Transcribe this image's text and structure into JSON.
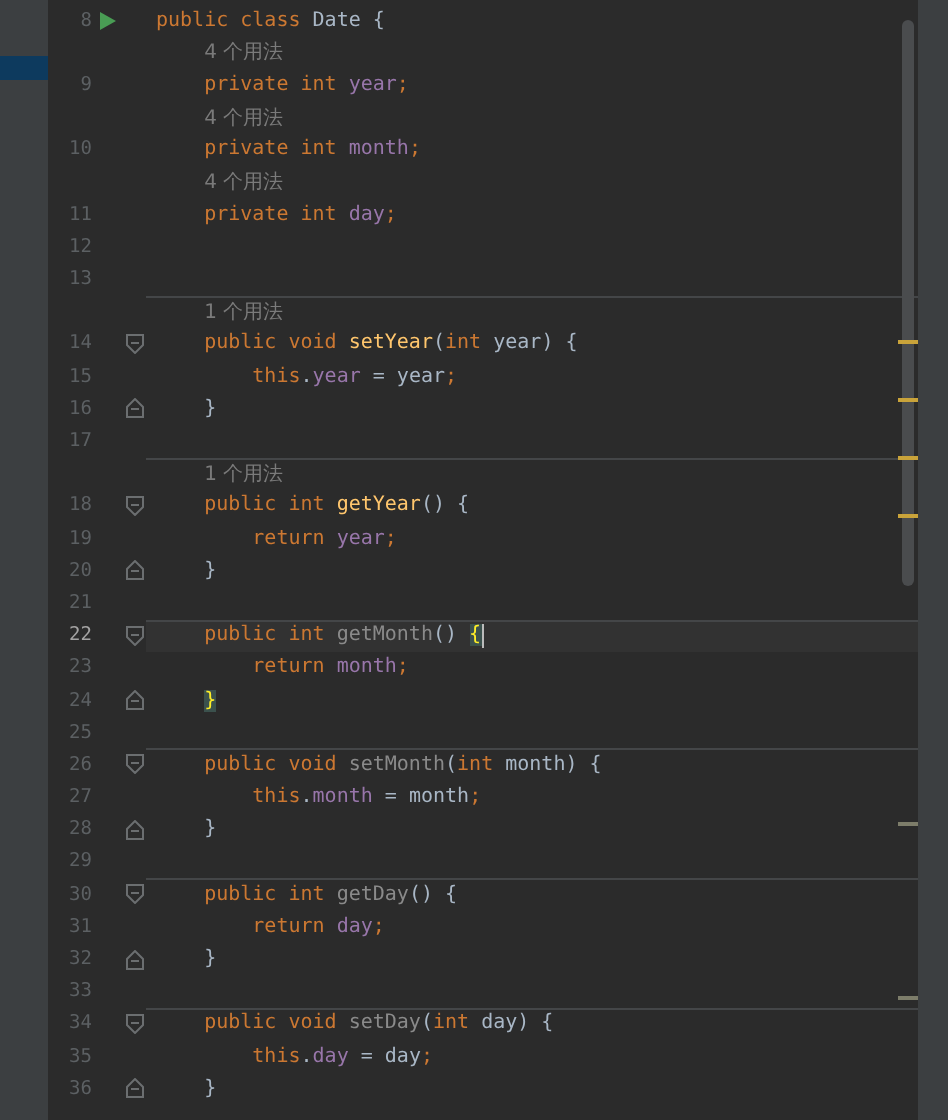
{
  "project_panel": {
    "row_highlighted": true
  },
  "editor": {
    "lines": [
      {
        "kind": "code",
        "number": "8",
        "run": true,
        "tokens": [
          {
            "keyword": "public class "
          },
          {
            "plain": "Date {"
          }
        ],
        "children": [
          {
            "kind": "hint",
            "text": "4 个用法"
          },
          {
            "kind": "code",
            "number": "9",
            "tokens": [
              {
                "keyword": "private int "
              },
              {
                "field": "year"
              },
              {
                "keyword": ";"
              }
            ]
          },
          {
            "kind": "hint",
            "text": "4 个用法"
          },
          {
            "kind": "code",
            "number": "10",
            "tokens": [
              {
                "keyword": "private int "
              },
              {
                "field": "month"
              },
              {
                "keyword": ";"
              }
            ]
          },
          {
            "kind": "hint",
            "text": "4 个用法"
          },
          {
            "kind": "code",
            "number": "11",
            "tokens": [
              {
                "keyword": "private int "
              },
              {
                "field": "day"
              },
              {
                "keyword": ";"
              }
            ]
          },
          {
            "kind": "code",
            "number": "12"
          },
          {
            "kind": "code",
            "number": "13"
          },
          {
            "kind": "hint",
            "text": "1 个用法",
            "separator": true
          },
          {
            "kind": "code",
            "number": "14",
            "fold_start": true,
            "tokens": [
              {
                "keyword": "public void "
              },
              {
                "declaration": "setYear"
              },
              {
                "plain": "("
              },
              {
                "keyword": "int "
              },
              {
                "plain": "year) {"
              }
            ],
            "children": [
              {
                "kind": "code",
                "number": "15",
                "tokens": [
                  {
                    "keyword": "this"
                  },
                  {
                    "plain": "."
                  },
                  {
                    "field": "year"
                  },
                  {
                    "plain": " = year"
                  },
                  {
                    "keyword": ";"
                  }
                ]
              }
            ]
          },
          {
            "kind": "code",
            "number": "16",
            "fold_end": true,
            "tokens": [
              {
                "plain": "}"
              }
            ]
          },
          {
            "kind": "code",
            "number": "17"
          },
          {
            "kind": "hint",
            "text": "1 个用法",
            "separator": true
          },
          {
            "kind": "code",
            "number": "18",
            "fold_start": true,
            "tokens": [
              {
                "keyword": "public int "
              },
              {
                "declaration": "getYear"
              },
              {
                "plain": "() {"
              }
            ],
            "children": [
              {
                "kind": "code",
                "number": "19",
                "tokens": [
                  {
                    "keyword": "return "
                  },
                  {
                    "field": "year"
                  },
                  {
                    "keyword": ";"
                  }
                ]
              }
            ]
          },
          {
            "kind": "code",
            "number": "20",
            "fold_end": true,
            "tokens": [
              {
                "plain": "}"
              }
            ]
          },
          {
            "kind": "code",
            "number": "21"
          },
          {
            "kind": "code",
            "number": "22",
            "fold_start": true,
            "separator": true,
            "current": true,
            "caret": true,
            "tokens": [
              {
                "keyword": "public int "
              },
              {
                "unused": "getMonth"
              },
              {
                "plain": "() "
              },
              {
                "brace_match": "{"
              }
            ],
            "children": [
              {
                "kind": "code",
                "number": "23",
                "tokens": [
                  {
                    "keyword": "return "
                  },
                  {
                    "field": "month"
                  },
                  {
                    "keyword": ";"
                  }
                ]
              }
            ]
          },
          {
            "kind": "code",
            "number": "24",
            "fold_end": true,
            "tokens": [
              {
                "brace_match": "}"
              }
            ]
          },
          {
            "kind": "code",
            "number": "25"
          },
          {
            "kind": "code",
            "number": "26",
            "fold_start": true,
            "separator": true,
            "tokens": [
              {
                "keyword": "public void "
              },
              {
                "unused": "setMonth"
              },
              {
                "plain": "("
              },
              {
                "keyword": "int "
              },
              {
                "plain": "month) {"
              }
            ],
            "children": [
              {
                "kind": "code",
                "number": "27",
                "tokens": [
                  {
                    "keyword": "this"
                  },
                  {
                    "plain": "."
                  },
                  {
                    "field": "month"
                  },
                  {
                    "plain": " = month"
                  },
                  {
                    "keyword": ";"
                  }
                ]
              }
            ]
          },
          {
            "kind": "code",
            "number": "28",
            "fold_end": true,
            "tokens": [
              {
                "plain": "}"
              }
            ]
          },
          {
            "kind": "code",
            "number": "29"
          },
          {
            "kind": "code",
            "number": "30",
            "fold_start": true,
            "separator": true,
            "tokens": [
              {
                "keyword": "public int "
              },
              {
                "unused": "getDay"
              },
              {
                "plain": "() {"
              }
            ],
            "children": [
              {
                "kind": "code",
                "number": "31",
                "tokens": [
                  {
                    "keyword": "return "
                  },
                  {
                    "field": "day"
                  },
                  {
                    "keyword": ";"
                  }
                ]
              }
            ]
          },
          {
            "kind": "code",
            "number": "32",
            "fold_end": true,
            "tokens": [
              {
                "plain": "}"
              }
            ]
          },
          {
            "kind": "code",
            "number": "33"
          },
          {
            "kind": "code",
            "number": "34",
            "fold_start": true,
            "separator": true,
            "tokens": [
              {
                "keyword": "public void "
              },
              {
                "unused": "setDay"
              },
              {
                "plain": "("
              },
              {
                "keyword": "int "
              },
              {
                "plain": "day) {"
              }
            ],
            "children": [
              {
                "kind": "code",
                "number": "35",
                "tokens": [
                  {
                    "keyword": "this"
                  },
                  {
                    "plain": "."
                  },
                  {
                    "field": "day"
                  },
                  {
                    "plain": " = day"
                  },
                  {
                    "keyword": ";"
                  }
                ]
              }
            ]
          },
          {
            "kind": "code",
            "number": "36",
            "fold_end": true,
            "tokens": [
              {
                "plain": "}"
              }
            ]
          }
        ]
      }
    ]
  }
}
